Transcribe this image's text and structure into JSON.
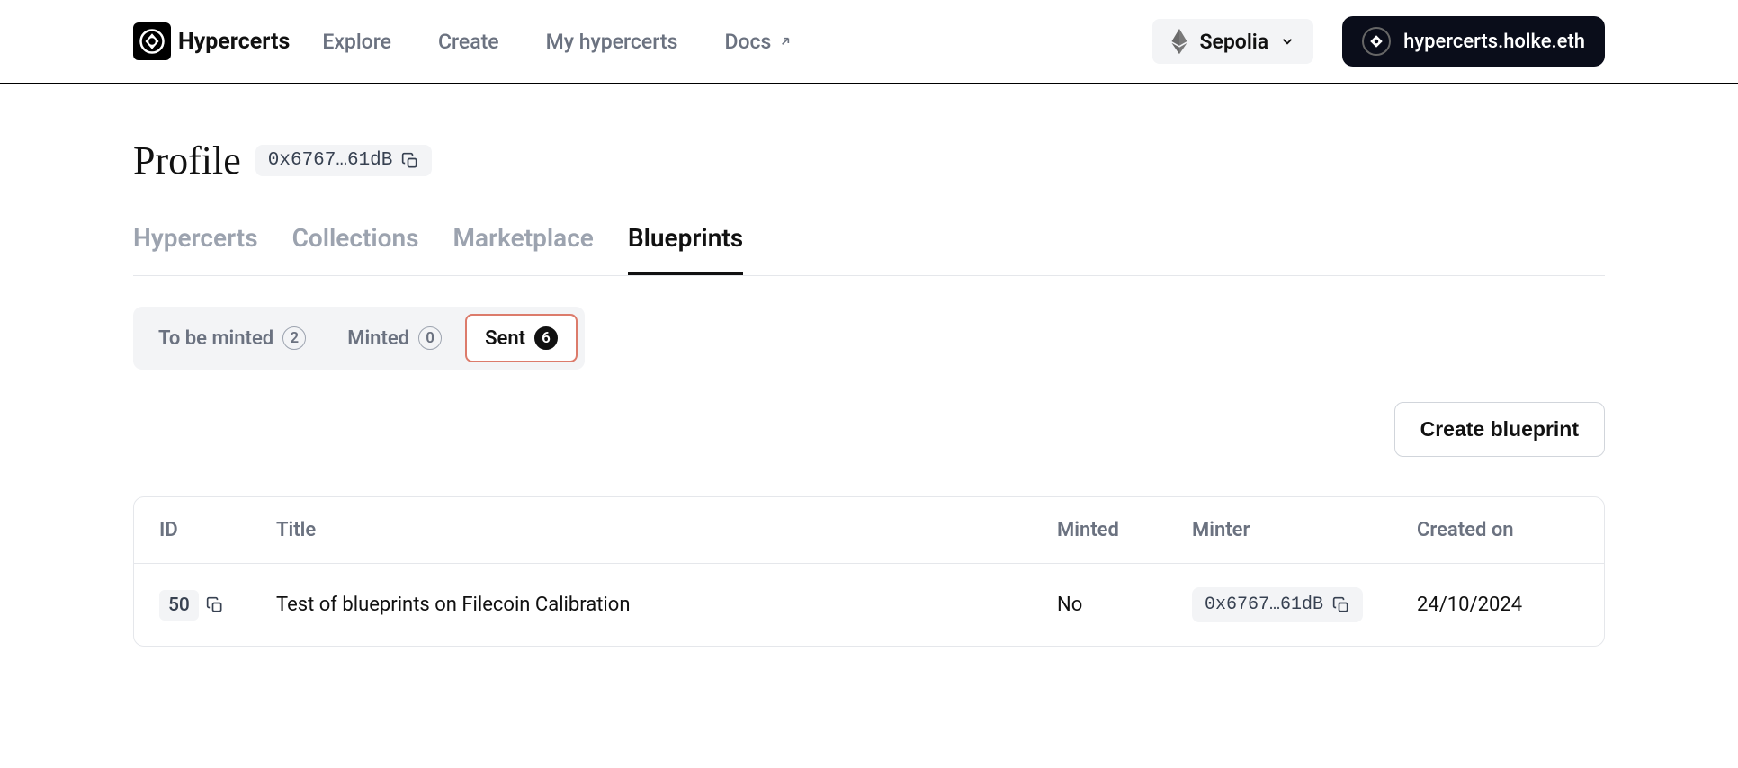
{
  "header": {
    "brand": "Hypercerts",
    "nav": {
      "explore": "Explore",
      "create": "Create",
      "myHypercerts": "My hypercerts",
      "docs": "Docs"
    },
    "network": "Sepolia",
    "account": "hypercerts.holke.eth"
  },
  "profile": {
    "title": "Profile",
    "address": "0x6767…61dB"
  },
  "tabs": {
    "hypercerts": "Hypercerts",
    "collections": "Collections",
    "marketplace": "Marketplace",
    "blueprints": "Blueprints"
  },
  "filters": {
    "toBeMinted": {
      "label": "To be minted",
      "count": "2"
    },
    "minted": {
      "label": "Minted",
      "count": "0"
    },
    "sent": {
      "label": "Sent",
      "count": "6"
    }
  },
  "createButton": "Create blueprint",
  "table": {
    "headers": {
      "id": "ID",
      "title": "Title",
      "minted": "Minted",
      "minter": "Minter",
      "createdOn": "Created on"
    },
    "rows": [
      {
        "id": "50",
        "title": "Test of blueprints on Filecoin Calibration",
        "minted": "No",
        "minter": "0x6767…61dB",
        "createdOn": "24/10/2024"
      }
    ]
  }
}
